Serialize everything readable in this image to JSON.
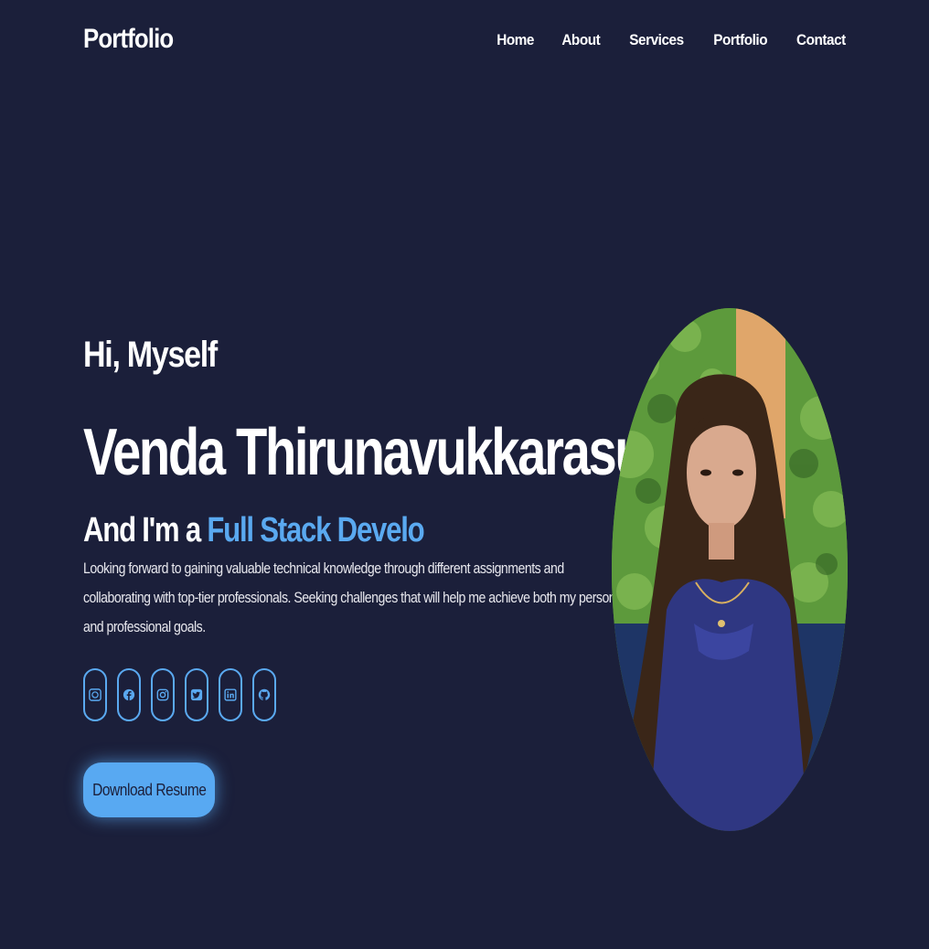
{
  "brand": {
    "logo": "Portfolio"
  },
  "nav": {
    "items": [
      {
        "label": "Home"
      },
      {
        "label": "About"
      },
      {
        "label": "Services"
      },
      {
        "label": "Portfolio"
      },
      {
        "label": "Contact"
      }
    ]
  },
  "hero": {
    "greeting": "Hi, Myself",
    "name": "Venda Thirunavukkarasu",
    "role_prefix": "And I'm a ",
    "role_typed": "Full Stack Develo",
    "bio": "Looking forward to gaining valuable technical knowledge through different assignments and collaborating with top-tier professionals. Seeking challenges that will help me achieve both my personal and professional goals.",
    "download_label": "Download Resume"
  },
  "socials": [
    {
      "icon": "whatsapp-icon"
    },
    {
      "icon": "facebook-icon"
    },
    {
      "icon": "instagram-icon"
    },
    {
      "icon": "twitter-icon"
    },
    {
      "icon": "linkedin-icon"
    },
    {
      "icon": "github-icon"
    }
  ],
  "colors": {
    "background": "#1b1f3a",
    "accent": "#5aa9f0",
    "button": "#58a9f2",
    "text": "#ffffff"
  }
}
